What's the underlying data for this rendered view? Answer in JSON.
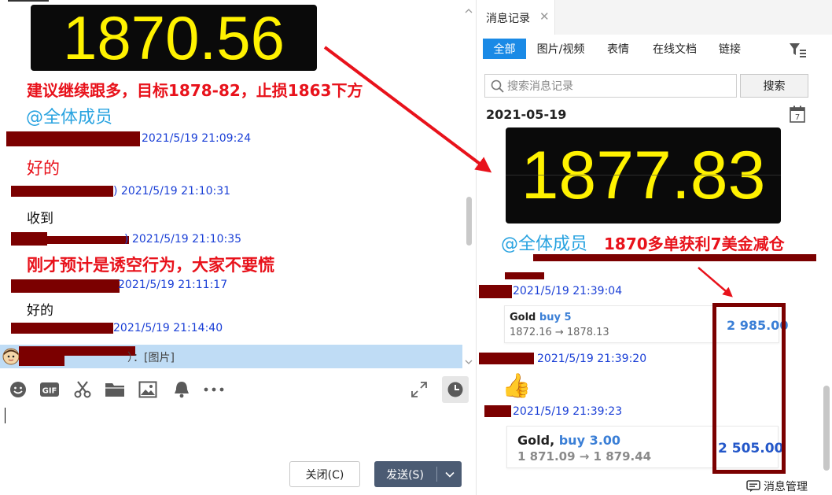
{
  "left": {
    "price_image_top": "1870.56",
    "annotation_1": "建议继续跟多，目标1878-82，止损1863下方",
    "mention": "@全体成员",
    "messages": [
      {
        "time": "2021/5/19 21:09:24",
        "text": "好的"
      },
      {
        "time": ") 2021/5/19 21:10:31",
        "text": "收到"
      },
      {
        "time": ") 2021/5/19 21:10:35",
        "text": "刚才预计是诱空行为，大家不要慌"
      },
      {
        "time": "2021/5/19 21:11:17",
        "text": "好的"
      },
      {
        "time": " 2021/5/19 21:14:40"
      }
    ],
    "notice": "）：[图片]",
    "close_button": "关闭(C)",
    "send_button": "发送(S)",
    "colors": {
      "annotation": "#e8121b",
      "mask": "#7b0000",
      "timestamp": "#1a3fd6",
      "send_bg": "#4b5b73"
    }
  },
  "right": {
    "tab_title": "消息记录",
    "tab_close": "✕",
    "filters": [
      "全部",
      "图片/视频",
      "表情",
      "在线文档",
      "链接"
    ],
    "search_placeholder": "搜索消息记录",
    "search_button": "搜索",
    "date_header": "2021-05-19",
    "price_image": "1877.83",
    "mention": "@全体成员",
    "annotation_2": "1870多单获利7美金减仓",
    "entries": [
      {
        "time": "2021/5/19 21:39:04",
        "trade": {
          "symbol": "Gold",
          "side": "buy 5",
          "prices": "1872.16 → 1878.13",
          "amount": "2 985.00"
        }
      },
      {
        "time": "2021/5/19 21:39:20",
        "emoji": "👍"
      },
      {
        "time": "2021/5/19 21:39:23",
        "trade": {
          "symbol": "Gold,",
          "side": "buy 3.00",
          "prices": "1 871.09 → 1 879.44",
          "amount": "2 505.00"
        }
      }
    ],
    "footer_button": "消息管理",
    "colors": {
      "filter_active": "#1a8ae6",
      "trade_blue": "#3b7fd6"
    }
  }
}
